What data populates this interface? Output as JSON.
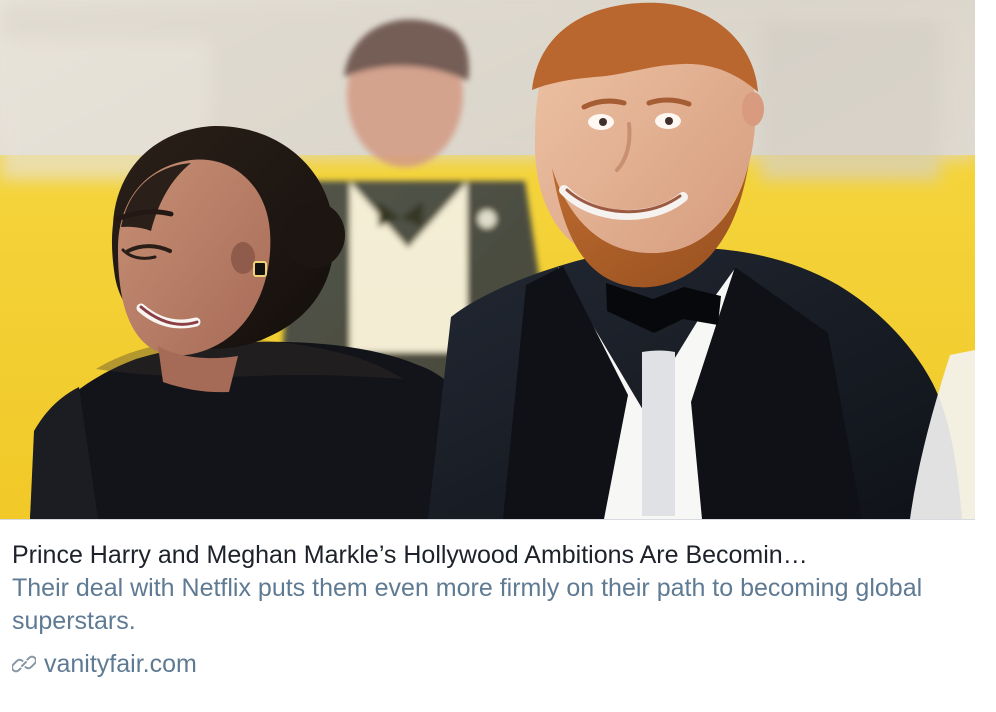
{
  "card": {
    "title": "Prince Harry and Meghan Markle’s Hollywood Ambitions Are Becomin…",
    "description": "Their deal with Netflix puts them even more firmly on their path to becoming global superstars.",
    "domain": "vanityfair.com",
    "icons": {
      "domain": "link-icon"
    }
  },
  "colors": {
    "title": "#1d2129",
    "description": "#5f7a93",
    "domain": "#5f7a93",
    "divider": "#d7dbe0"
  }
}
